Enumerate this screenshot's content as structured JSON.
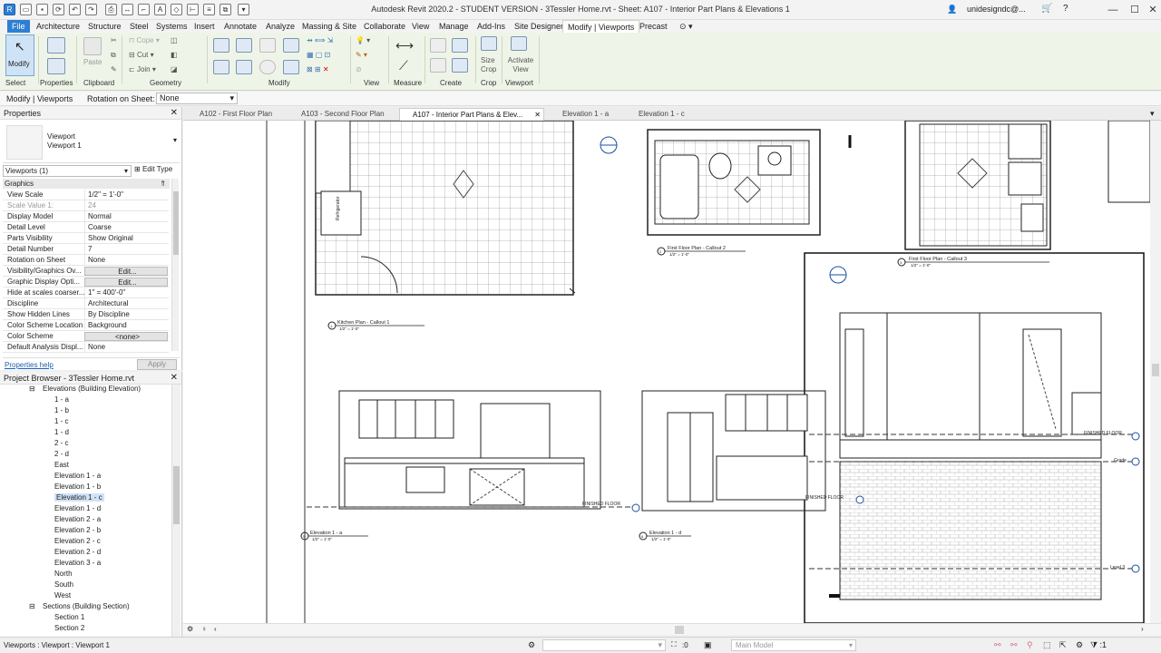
{
  "window": {
    "title": "Autodesk Revit 2020.2 - STUDENT VERSION - 3Tessler Home.rvt - Sheet: A107 - Interior Part Plans & Elevations 1",
    "user": "unidesigndc@...",
    "minimize": "—",
    "maximize": "☐",
    "close": "✕"
  },
  "menu": {
    "tabs": [
      "File",
      "Architecture",
      "Structure",
      "Steel",
      "Systems",
      "Insert",
      "Annotate",
      "Analyze",
      "Massing & Site",
      "Collaborate",
      "View",
      "Manage",
      "Add-Ins",
      "Site Designer",
      "Modify | Viewports",
      "Precast"
    ]
  },
  "ribbon": {
    "modify_label": "Modify",
    "paste_label": "Paste",
    "cope_label": "Cope",
    "cut_label": "Cut",
    "join_label": "Join",
    "size_crop_label": "Size Crop",
    "activate_view_label": "Activate View",
    "panels": {
      "select": "Select",
      "properties": "Properties",
      "clipboard": "Clipboard",
      "geometry": "Geometry",
      "modify": "Modify",
      "view": "View",
      "measure": "Measure",
      "create": "Create",
      "crop": "Crop",
      "viewport": "Viewport"
    }
  },
  "options_bar": {
    "context": "Modify | Viewports",
    "rotation_label": "Rotation on Sheet:",
    "rotation_value": "None"
  },
  "properties": {
    "header": "Properties",
    "type_name_1": "Viewport",
    "type_name_2": "Viewport 1",
    "selector": "Viewports (1)",
    "edit_type": "Edit Type",
    "group": "Graphics",
    "rows": [
      {
        "k": "View Scale",
        "v": "1/2\" = 1'-0\""
      },
      {
        "k": "Scale Value    1:",
        "v": "24"
      },
      {
        "k": "Display Model",
        "v": "Normal"
      },
      {
        "k": "Detail Level",
        "v": "Coarse"
      },
      {
        "k": "Parts Visibility",
        "v": "Show Original"
      },
      {
        "k": "Detail Number",
        "v": "7"
      },
      {
        "k": "Rotation on Sheet",
        "v": "None"
      },
      {
        "k": "Visibility/Graphics Ov...",
        "v": "Edit..."
      },
      {
        "k": "Graphic Display Opti...",
        "v": "Edit..."
      },
      {
        "k": "Hide at scales coarser...",
        "v": "1\" = 400'-0\""
      },
      {
        "k": "Discipline",
        "v": "Architectural"
      },
      {
        "k": "Show Hidden Lines",
        "v": "By Discipline"
      },
      {
        "k": "Color Scheme Location",
        "v": "Background"
      },
      {
        "k": "Color Scheme",
        "v": "<none>"
      },
      {
        "k": "Default Analysis Displ...",
        "v": "None"
      }
    ],
    "help_link": "Properties help",
    "apply": "Apply"
  },
  "project_browser": {
    "header": "Project Browser - 3Tessler Home.rvt",
    "elevations_group": "Elevations (Building Elevation)",
    "elevations": [
      "1 - a",
      "1 - b",
      "1 - c",
      "1 - d",
      "2 - c",
      "2 - d",
      "East",
      "Elevation 1 - a",
      "Elevation 1 - b",
      "Elevation 1 - c",
      "Elevation 1 - d",
      "Elevation 2 - a",
      "Elevation 2 - b",
      "Elevation 2 - c",
      "Elevation 2 - d",
      "Elevation 3 - a",
      "North",
      "South",
      "West"
    ],
    "selected": "Elevation 1 - c",
    "sections_group": "Sections (Building Section)",
    "sections": [
      "Section 1",
      "Section 2"
    ]
  },
  "view_tabs": [
    "A102 - First Floor Plan",
    "A103 - Second Floor Plan",
    "A107 - Interior Part Plans & Elev...",
    "Elevation 1 - a",
    "Elevation 1 - c"
  ],
  "drawing": {
    "callout_kitchen": "Kitchen Plan - Callout 1",
    "callout_kitchen_scale": "1/2\" = 1'-0\"",
    "callout_2": "First Floor Plan - Callout 2",
    "callout_2_scale": "1/2\" = 1'-0\"",
    "callout_3": "First Floor Plan - Callout 3",
    "callout_3_scale": "1/2\" = 1'-0\"",
    "elev_a": "Elevation 1 - a",
    "elev_a_scale": "1/2\" = 1'-0\"",
    "elev_d": "Elevation 1 - d",
    "elev_d_scale": "1/2\" = 1'-0\"",
    "finished_floor": "FINISHED FLOOR",
    "grade": "Grade",
    "level3": "Level 3",
    "refrigerator": "Refrigerator",
    "num_1": "1",
    "num_2": "2",
    "num_3": "3",
    "num_5": "5",
    "num_6": "6"
  },
  "status": {
    "left": "Viewports : Viewport : Viewport 1",
    "zero": ":0",
    "model": "Main Model"
  }
}
